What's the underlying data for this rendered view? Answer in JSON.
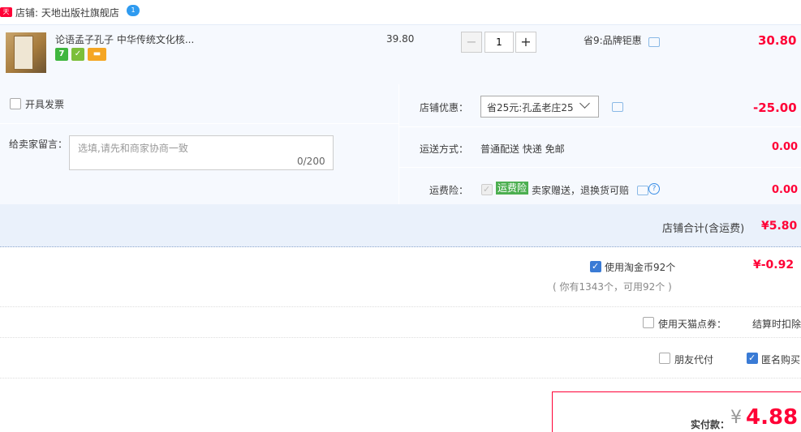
{
  "shop": {
    "badge": "天猫",
    "label": "店铺: 天地出版社旗舰店",
    "chat_badge": "1"
  },
  "item": {
    "title": "论语孟子孔子 中华传统文化核...",
    "services": [
      {
        "icon": "seven-day-return-icon",
        "text": "7",
        "color": "#3fb63f"
      },
      {
        "icon": "tmall-guarantee-icon",
        "text": "✓",
        "color": "#7cbf3a"
      },
      {
        "icon": "credit-card-icon",
        "text": "▬",
        "color": "#f5a623"
      }
    ],
    "price": "39.80",
    "quantity": "1",
    "promo": "省9:品牌钜惠",
    "subtotal": "30.80"
  },
  "options": {
    "invoice_label": "开具发票",
    "message_label": "给卖家留言：",
    "message_placeholder": "选填,请先和商家协商一致",
    "message_count": "0/200",
    "shop_discount_label": "店铺优惠：",
    "shop_discount_selected": "省25元:孔孟老庄25",
    "shop_discount_amount": "-25.00",
    "shipping_label": "运送方式：",
    "shipping_value": "普通配送 快递 免邮",
    "shipping_amount": "0.00",
    "insurance_label": "运费险：",
    "insurance_badge": "运费险",
    "insurance_text": "卖家赠送，退换货可赔",
    "insurance_amount": "0.00"
  },
  "shop_total": {
    "label": "店铺合计(含运费)",
    "amount": "¥5.80"
  },
  "coins": {
    "label": "使用淘金币92个",
    "amount": "¥-0.92",
    "hint": "( 你有1343个，可用92个 )"
  },
  "coupon": {
    "label": "使用天猫点券：",
    "value": "结算时扣除"
  },
  "friend_pay": {
    "label": "朋友代付"
  },
  "anonymous": {
    "label": "匿名购买"
  },
  "payment": {
    "label": "实付款：",
    "currency": "¥",
    "amount": "4.88"
  },
  "colors": {
    "accent": "#ff0036",
    "row_bg": "#f6f9fe",
    "check_blue": "#3a7bd5"
  }
}
